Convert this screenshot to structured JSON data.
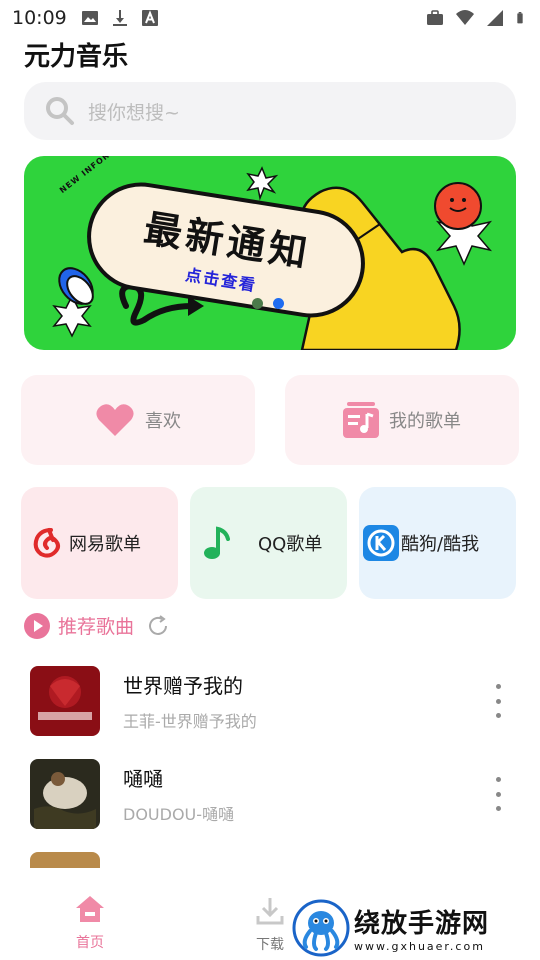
{
  "status_bar": {
    "time": "10:09",
    "left_icons": [
      "image-icon",
      "download-icon",
      "text-a-icon"
    ],
    "right_icons": [
      "briefcase-icon",
      "wifi-icon",
      "signal-icon",
      "battery-icon"
    ]
  },
  "app": {
    "title": "元力音乐"
  },
  "search": {
    "placeholder": "搜你想搜~"
  },
  "banner": {
    "tag": "NEW INFORMARTION",
    "title": "最新通知",
    "subtitle": "点击查看",
    "page_count": 2,
    "active_page": 2,
    "bg_color": "#2fd33c"
  },
  "shortcuts": {
    "like": {
      "label": "喜欢",
      "icon": "heart-icon"
    },
    "my_playlist": {
      "label": "我的歌单",
      "icon": "playlist-icon"
    }
  },
  "sources": [
    {
      "label": "网易歌单",
      "icon": "netease-icon",
      "bg": "#fde9ec"
    },
    {
      "label": "QQ歌单",
      "icon": "qq-music-icon",
      "bg": "#e9f7ee"
    },
    {
      "label": "酷狗/酷我",
      "icon": "kugou-icon",
      "bg": "#e8f3fc"
    }
  ],
  "recommended": {
    "title": "推荐歌曲",
    "songs": [
      {
        "title": "世界赠予我的",
        "subtitle": "王菲-世界赠予我的"
      },
      {
        "title": "嗵嗵",
        "subtitle": "DOUDOU-嗵嗵"
      }
    ]
  },
  "bottom_nav": {
    "home": "首页",
    "download": "下载"
  },
  "watermark": {
    "main": "绕放手游网",
    "url": "www.gxhuaer.com"
  },
  "colors": {
    "accent": "#e9749a",
    "blue": "#1e6cf0"
  }
}
